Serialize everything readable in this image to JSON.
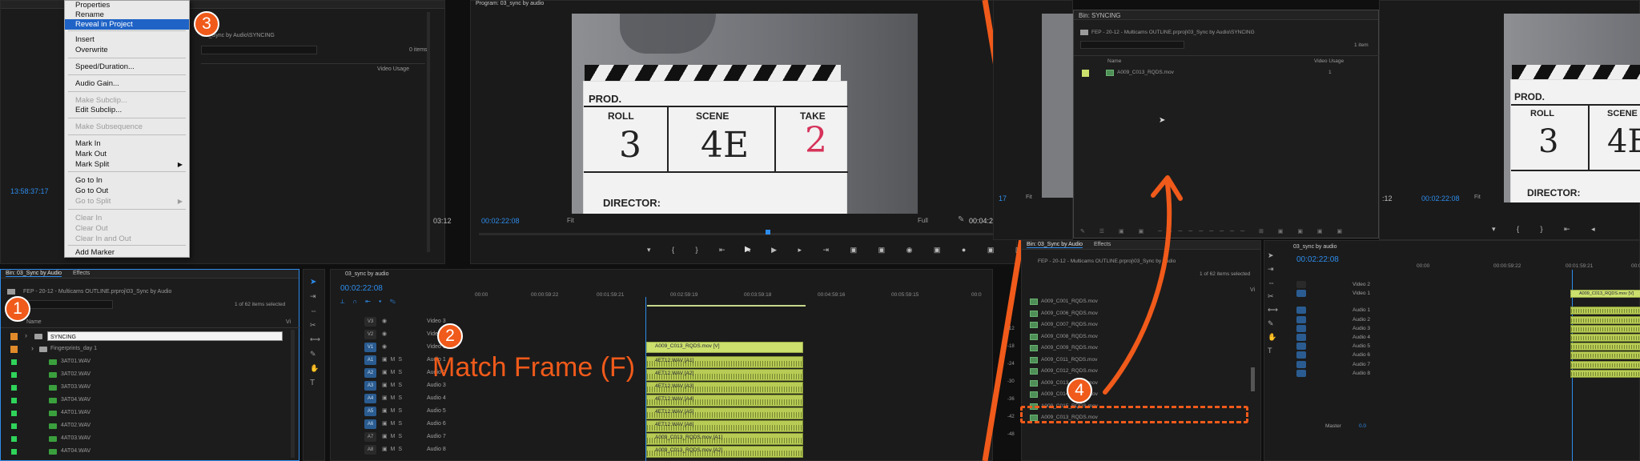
{
  "context_menu": {
    "items": [
      {
        "label": "Properties",
        "state": "normal"
      },
      {
        "label": "Rename",
        "state": "normal"
      },
      {
        "label": "Reveal in Project",
        "state": "highlight"
      },
      {
        "label": "Insert",
        "state": "normal"
      },
      {
        "label": "Overwrite",
        "state": "normal"
      },
      {
        "label": "Speed/Duration...",
        "state": "normal"
      },
      {
        "label": "Audio Gain...",
        "state": "normal"
      },
      {
        "label": "Make Subclip...",
        "state": "disabled"
      },
      {
        "label": "Edit Subclip...",
        "state": "normal"
      },
      {
        "label": "Make Subsequence",
        "state": "disabled"
      },
      {
        "label": "Mark In",
        "state": "normal"
      },
      {
        "label": "Mark Out",
        "state": "normal"
      },
      {
        "label": "Mark Split",
        "state": "normal"
      },
      {
        "label": "Go to In",
        "state": "normal"
      },
      {
        "label": "Go to Out",
        "state": "normal"
      },
      {
        "label": "Go to Split",
        "state": "disabled"
      },
      {
        "label": "Clear In",
        "state": "disabled"
      },
      {
        "label": "Clear Out",
        "state": "disabled"
      },
      {
        "label": "Clear In and Out",
        "state": "disabled"
      },
      {
        "label": "Add Marker",
        "state": "normal"
      }
    ]
  },
  "source_panel": {
    "path": "\\03_Sync by Audio\\SYNCING",
    "items_count": "0 items",
    "col_video_usage": "Video Usage",
    "timecode_left": "13:58:37:17",
    "timecode_right": "03:12"
  },
  "bin_panel": {
    "tabs": [
      "Bin: 03_Sync by Audio",
      "Effects"
    ],
    "path": "FEP - 20-12 - Multicams OUTLINE.prproj\\03_Sync by Audio",
    "selected_count": "1 of 62 items selected",
    "col_name": "Name",
    "col_vi": "Vi",
    "search_value": "",
    "rows": [
      "SYNCING",
      "Fingerprints_day 1",
      "3AT01.WAV",
      "3AT02.WAV",
      "3AT03.WAV",
      "3AT04.WAV",
      "4AT01.WAV",
      "4AT02.WAV",
      "4AT03.WAV",
      "4AT04.WAV"
    ]
  },
  "program_monitor": {
    "title": "Program: 03_sync by audio",
    "timecode": "00:02:22:08",
    "fit": "Fit",
    "quality": "Full",
    "duration": "00:04:24:22",
    "slate": {
      "prod": "PROD.",
      "roll": "ROLL",
      "scene": "SCENE",
      "take": "TAKE",
      "director": "DIRECTOR:",
      "roll_val": "3",
      "scene_val": "4E",
      "take_val": "2"
    }
  },
  "timeline": {
    "tab": "03_sync by audio",
    "timecode": "00:02:22:08",
    "ruler": [
      "00:00",
      "00:00:59:22",
      "00:01:59:21",
      "00:02:59:19",
      "00:03:59:18",
      "00:04:59:16",
      "00:05:59:15",
      "00:0"
    ],
    "tracks": [
      {
        "id": "V3",
        "name": "Video 3"
      },
      {
        "id": "V2",
        "name": "Video 2"
      },
      {
        "id": "V1",
        "name": "Video 1"
      },
      {
        "id": "A1",
        "name": "Audio 1"
      },
      {
        "id": "A2",
        "name": "Audio 2"
      },
      {
        "id": "A3",
        "name": "Audio 3"
      },
      {
        "id": "A4",
        "name": "Audio 4"
      },
      {
        "id": "A5",
        "name": "Audio 5"
      },
      {
        "id": "A6",
        "name": "Audio 6"
      },
      {
        "id": "A7",
        "name": "Audio 7"
      },
      {
        "id": "A8",
        "name": "Audio 8"
      }
    ],
    "video_clip": "A009_C013_RQDS.mov [V]",
    "audio_clips": [
      "4ET12.WAV [A1]",
      "4ET12.WAV [A2]",
      "4ET12.WAV [A3]",
      "4ET12.WAV [A4]",
      "4ET12.WAV [A5]",
      "4ET12.WAV [A6]",
      "A009_C013_RQDS.mov [A1]",
      "A009_C013_RQDS.mov [A2]"
    ]
  },
  "annotation": {
    "match_frame": "Match Frame (F)",
    "badges": [
      "1",
      "2",
      "3",
      "4"
    ]
  },
  "syncing_bin": {
    "title": "Bin: SYNCING",
    "path": "FEP - 20-12 - Multicams OUTLINE.prproj\\03_Sync by Audio\\SYNCING",
    "count": "1 item",
    "col_name": "Name",
    "col_video_usage": "Video Usage",
    "row_name": "A009_C013_RQDS.mov",
    "row_usage": "1"
  },
  "right_project": {
    "tabs": [
      "Bin: 03_Sync by Audio",
      "Effects"
    ],
    "path": "FEP - 20-12 - Multicams OUTLINE.prproj\\03_Sync by Audio",
    "count": "1 of 62 items selected",
    "col_vi": "Vi",
    "rows": [
      "A009_C001_RQDS.mov",
      "A009_C006_RQDS.mov",
      "A009_C007_RQDS.mov",
      "A009_C008_RQDS.mov",
      "A009_C009_RQDS.mov",
      "A009_C011_RQDS.mov",
      "A009_C012_RQDS.mov",
      "A009_C013_RQDS.mov",
      "A009_C014_RQDS.mov",
      "A009_C015_RQDS.mov",
      "A009_C013_RQDS.mov"
    ],
    "db_scale": [
      "-12",
      "-18",
      "-24",
      "-30",
      "-36",
      "-42",
      "-48"
    ],
    "timecode": "17",
    "fit": "Fit"
  },
  "right_monitor": {
    "timecode": "00:02:22:08",
    "fit": "Fit",
    "right_tc": ":12"
  },
  "right_timeline": {
    "tab": "03_sync by audio",
    "timecode": "00:02:22:08",
    "ruler": [
      "00:00",
      "00:00:59:22",
      "00:01:59:21",
      "00:0"
    ],
    "tracks": [
      "Video 2",
      "Video 1",
      "Audio 1",
      "Audio 2",
      "Audio 3",
      "Audio 4",
      "Audio 5",
      "Audio 6",
      "Audio 7",
      "Audio 8"
    ],
    "master": "Master",
    "master_val": "0.0",
    "video_clip": "A009_C013_RQDS.mov [V]"
  },
  "colors": {
    "accent": "#2d8ceb",
    "annotation": "#f05a1a",
    "clip": "#cbe06d",
    "menu_highlight": "#1f63c6"
  }
}
